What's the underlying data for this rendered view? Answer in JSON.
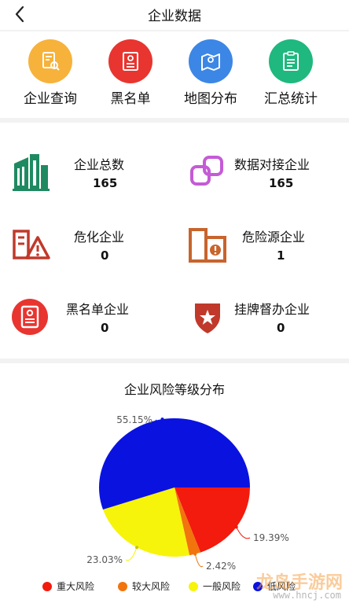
{
  "header": {
    "title": "企业数据"
  },
  "nav": [
    {
      "label": "企业查询",
      "color": "#f7b23b",
      "icon": "company-search-icon"
    },
    {
      "label": "黑名单",
      "color": "#e8352f",
      "icon": "blacklist-icon"
    },
    {
      "label": "地图分布",
      "color": "#3c86e6",
      "icon": "map-icon"
    },
    {
      "label": "汇总统计",
      "color": "#1fb87f",
      "icon": "clipboard-icon"
    }
  ],
  "stats": {
    "total": {
      "label": "企业总数",
      "value": "165",
      "color": "#1f8a62"
    },
    "connected": {
      "label": "数据对接企业",
      "value": "165",
      "color": "#c55bd6"
    },
    "hazardous": {
      "label": "危化企业",
      "value": "0",
      "color": "#c0392b"
    },
    "hazard_source": {
      "label": "危险源企业",
      "value": "1",
      "color": "#c8642c"
    },
    "blacklist": {
      "label": "黑名单企业",
      "value": "0",
      "color": "#e8352f"
    },
    "supervised": {
      "label": "挂牌督办企业",
      "value": "0",
      "color": "#c0392b"
    }
  },
  "chart_data": {
    "type": "pie",
    "title": "企业风险等级分布",
    "categories": [
      "重大风险",
      "较大风险",
      "一般风险",
      "低风险"
    ],
    "values": [
      19.39,
      2.42,
      23.03,
      55.15
    ],
    "labels": [
      "19.39%",
      "2.42%",
      "23.03%",
      "55.15%"
    ],
    "colors": [
      "#f21b0e",
      "#f2740c",
      "#f6f40a",
      "#0a12e0"
    ],
    "legend": "bottom"
  },
  "watermark": {
    "main": "龙岛手游网",
    "sub": "www.hncj.com"
  }
}
